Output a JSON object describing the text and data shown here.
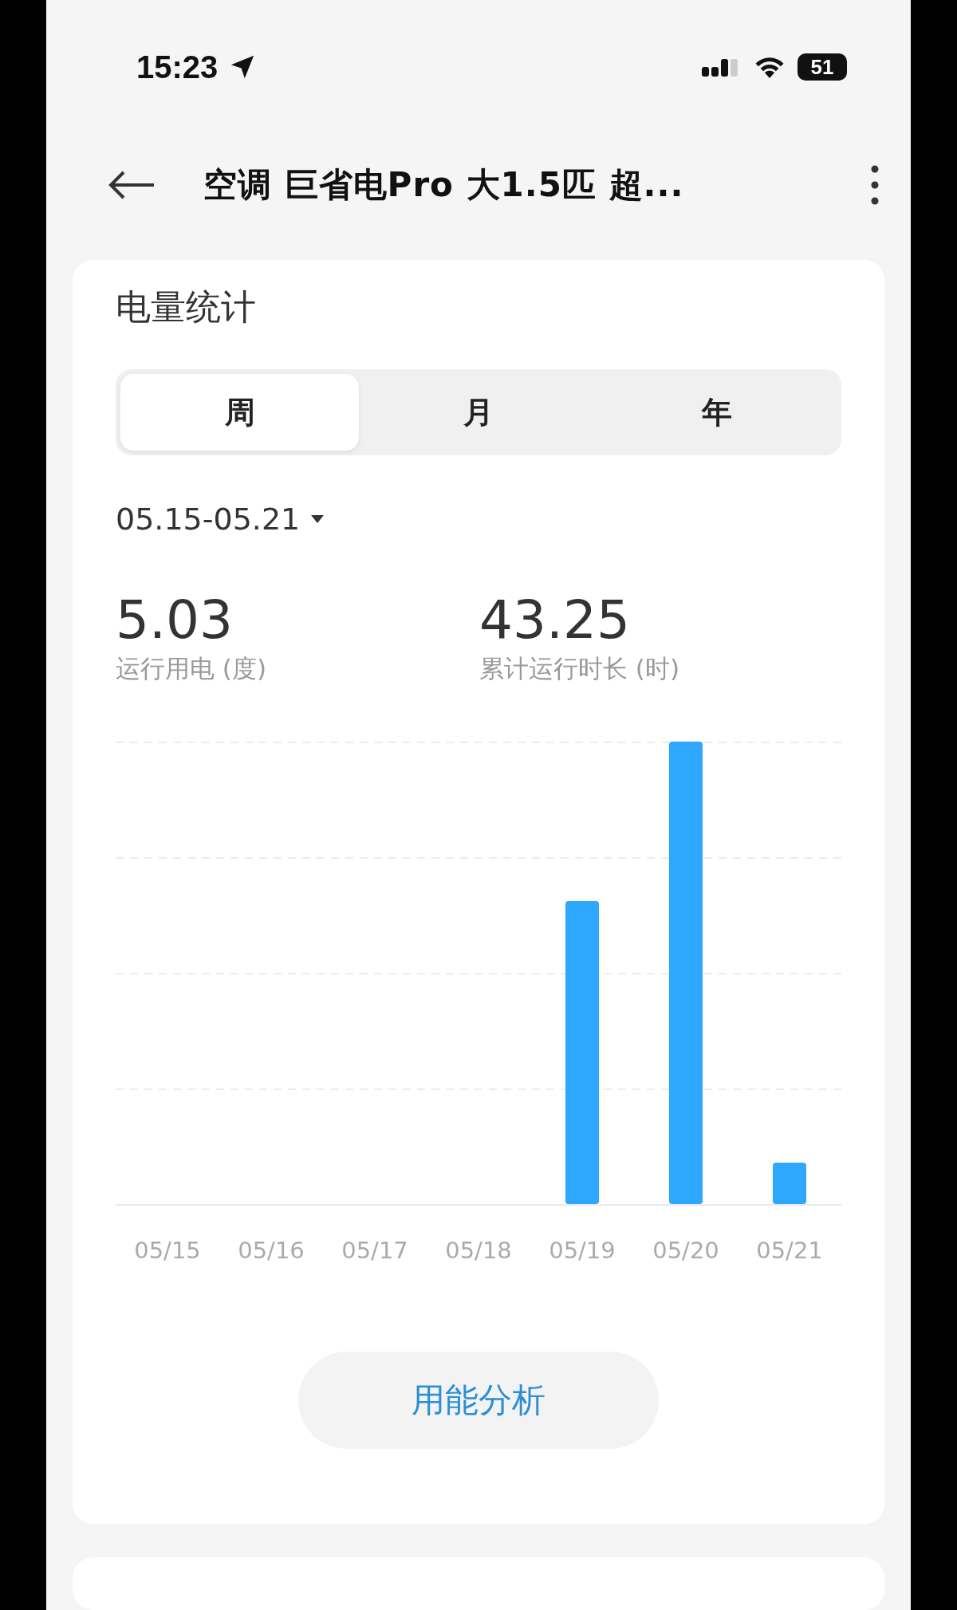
{
  "status_bar": {
    "time": "15:23",
    "battery": "51"
  },
  "nav": {
    "title": "空调 巨省电Pro 大1.5匹 超..."
  },
  "card": {
    "title": "电量统计",
    "tabs": [
      {
        "label": "周",
        "selected": true
      },
      {
        "label": "月",
        "selected": false
      },
      {
        "label": "年",
        "selected": false
      }
    ],
    "date_range": "05.15-05.21",
    "stats": [
      {
        "value": "5.03",
        "label": "运行用电 (度)"
      },
      {
        "value": "43.25",
        "label": "累计运行时长 (时)"
      }
    ],
    "chart_x_labels": [
      "05/15",
      "05/16",
      "05/17",
      "05/18",
      "05/19",
      "05/20",
      "05/21"
    ],
    "button": "用能分析"
  }
}
